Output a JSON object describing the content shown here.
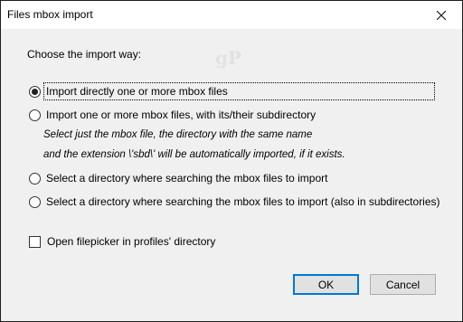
{
  "window": {
    "title": "Files mbox import",
    "close_icon": "close-icon"
  },
  "watermark": "gP",
  "heading": "Choose the import way:",
  "options": [
    {
      "label": "Import directly one or more mbox files",
      "checked": true
    },
    {
      "label": "Import one or more mbox files, with its/their subdirectory",
      "checked": false
    },
    {
      "label": "Select a directory where searching the mbox files to import",
      "checked": false
    },
    {
      "label": "Select a directory where searching the mbox files to import (also in subdirectories)",
      "checked": false
    }
  ],
  "note": {
    "line1": "Select just the mbox file, the directory with the same name",
    "line2": "and the extension \\'sbd\\' will be automatically imported, if it exists."
  },
  "checkbox": {
    "label": "Open filepicker in profiles' directory",
    "checked": false
  },
  "buttons": {
    "ok": "OK",
    "cancel": "Cancel"
  }
}
